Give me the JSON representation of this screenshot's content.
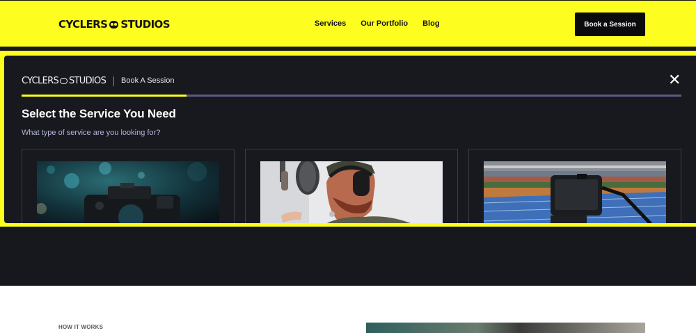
{
  "header": {
    "brand_left": "CYCLERS",
    "brand_right": "STUDIOS",
    "nav": [
      "Services",
      "Our Portfolio",
      "Blog"
    ],
    "cta": "Book a Session"
  },
  "modal": {
    "brand_left": "CYCLERS",
    "brand_right": "STUDIOS",
    "breadcrumb": "Book A Session",
    "close_icon": "close-icon",
    "progress_fraction": 0.25,
    "title": "Select the Service You Need",
    "subtitle": "What type of service are you looking for?",
    "cards": [
      {
        "image": "camera-photo"
      },
      {
        "image": "singer-recording-studio"
      },
      {
        "image": "stadium-camera-rig"
      }
    ]
  },
  "below": {
    "section_label": "HOW IT WORKS"
  },
  "colors": {
    "accent_yellow": "#fdfd1f",
    "modal_bg": "#17191e",
    "progress_track": "#5b5b86",
    "subtitle": "#b3b6d6"
  }
}
